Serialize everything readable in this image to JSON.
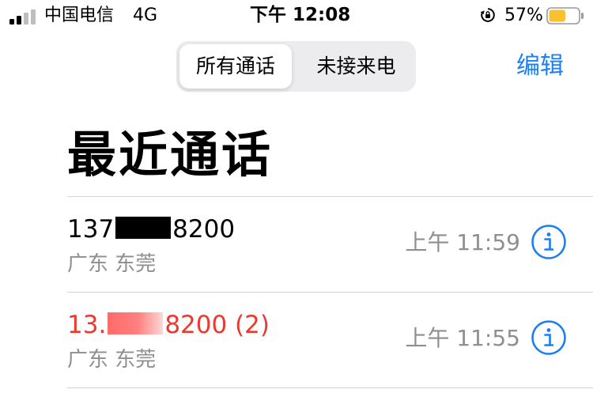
{
  "status_bar": {
    "carrier": "中国电信",
    "network": "4G",
    "time": "下午 12:08",
    "battery_percent": "57%",
    "battery_level": 0.57,
    "battery_color": "#f8c22f",
    "icons": [
      "signal-icon",
      "orientation-lock-icon",
      "battery-icon"
    ]
  },
  "nav": {
    "segments": [
      {
        "label": "所有通话",
        "selected": true
      },
      {
        "label": "未接来电",
        "selected": false
      }
    ],
    "edit_label": "编辑"
  },
  "title": "最近通话",
  "calls": [
    {
      "number_prefix": "137",
      "number_suffix": "8200",
      "count": "",
      "missed": false,
      "location": "广东 东莞",
      "time": "上午 11:59"
    },
    {
      "number_prefix": "13.",
      "number_suffix": "8200 (2)",
      "count": "(2)",
      "missed": true,
      "location": "广东 东莞",
      "time": "上午 11:55"
    }
  ],
  "colors": {
    "accent": "#1a7ff5",
    "missed": "#ea3a30",
    "secondary_text": "#8e8e93"
  }
}
